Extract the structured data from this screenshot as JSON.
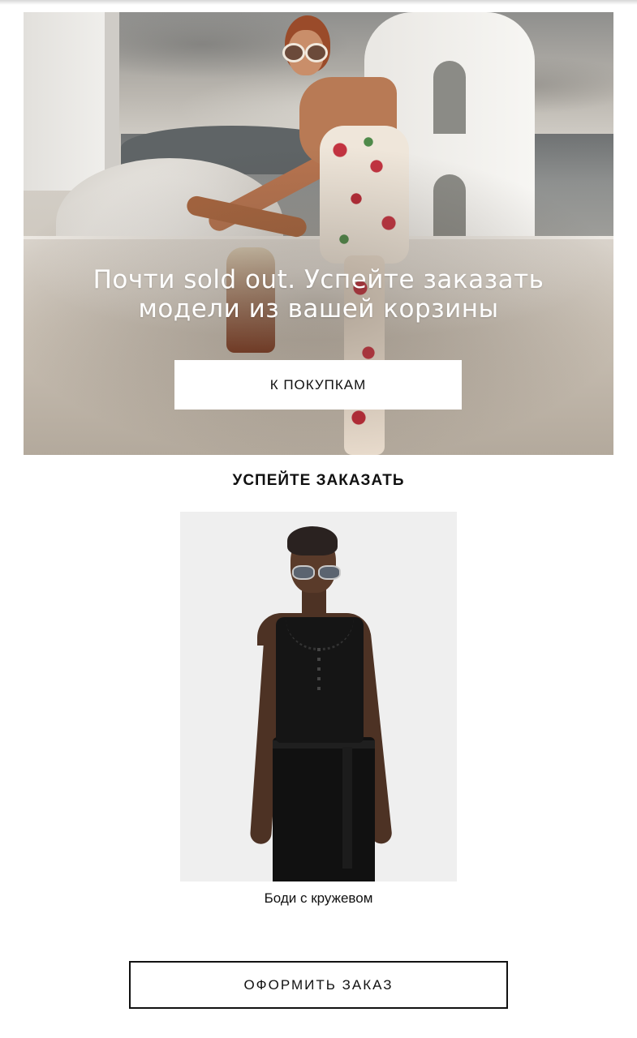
{
  "hero": {
    "headline_line1": "Почти sold out. Успейте заказать",
    "headline_line2": "модели из вашей корзины",
    "button_label": "К ПОКУПКАМ"
  },
  "section": {
    "title": "УСПЕЙТЕ ЗАКАЗАТЬ"
  },
  "product": {
    "name": "Боди с кружевом"
  },
  "checkout": {
    "button_label": "ОФОРМИТЬ ЗАКАЗ"
  },
  "colors": {
    "text": "#111111",
    "background": "#ffffff",
    "product_bg": "#efefef"
  }
}
